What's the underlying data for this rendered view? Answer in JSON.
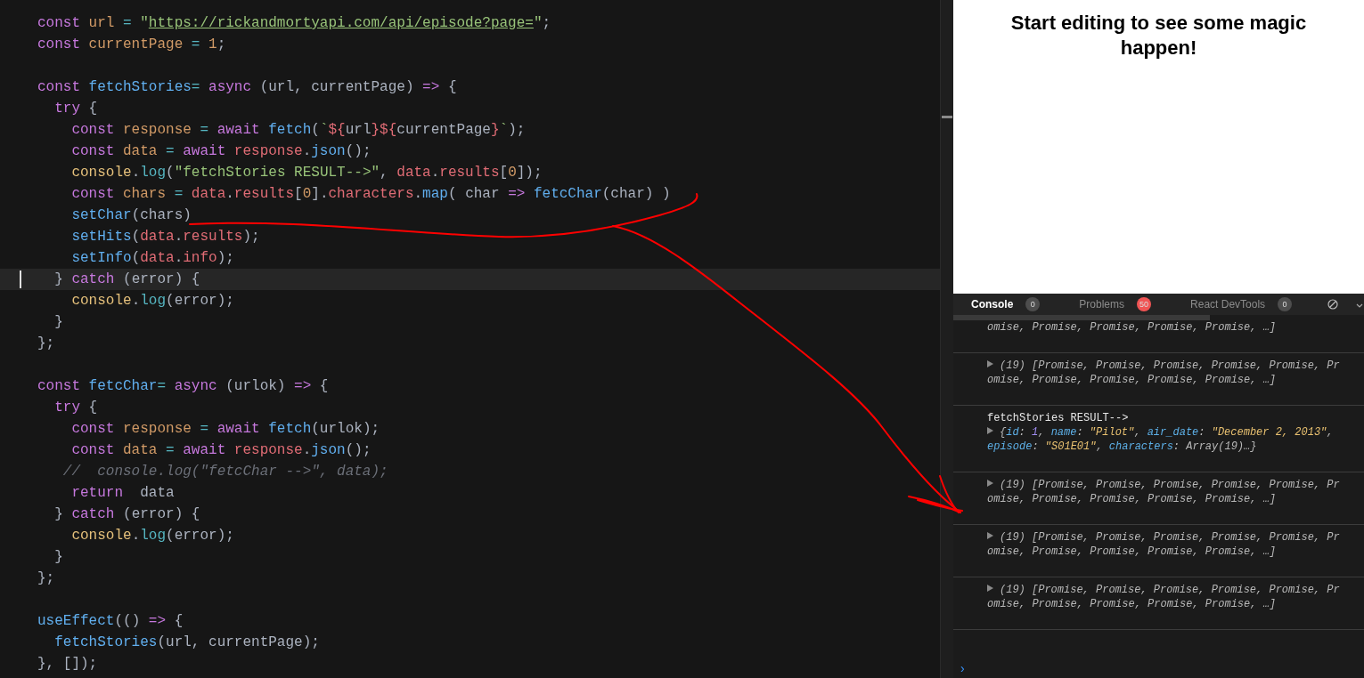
{
  "editor": {
    "lines": [
      {
        "current": false,
        "tokens": [
          {
            "kind": "keyword",
            "text": "const "
          },
          {
            "kind": "variable",
            "text": "url "
          },
          {
            "kind": "operator",
            "text": "= "
          },
          {
            "kind": "string",
            "text": "\""
          },
          {
            "kind": "link",
            "text": "https://rickandmortyapi.com/api/episode?page="
          },
          {
            "kind": "string",
            "text": "\""
          },
          {
            "kind": "plain",
            "text": ";"
          }
        ]
      },
      {
        "current": false,
        "tokens": [
          {
            "kind": "keyword",
            "text": "const "
          },
          {
            "kind": "variable",
            "text": "currentPage "
          },
          {
            "kind": "operator",
            "text": "= "
          },
          {
            "kind": "number",
            "text": "1"
          },
          {
            "kind": "plain",
            "text": ";"
          }
        ]
      },
      {
        "current": false,
        "blank_before": true,
        "tokens": [
          {
            "kind": "keyword",
            "text": "const "
          },
          {
            "kind": "function",
            "text": "fetchStories"
          },
          {
            "kind": "operator",
            "text": "= "
          },
          {
            "kind": "keyword",
            "text": "async"
          },
          {
            "kind": "plain",
            "text": " (url, currentPage) "
          },
          {
            "kind": "keyword",
            "text": "=>"
          },
          {
            "kind": "plain",
            "text": " {"
          }
        ]
      },
      {
        "current": false,
        "tokens": [
          {
            "kind": "keyword",
            "text": "  try"
          },
          {
            "kind": "plain",
            "text": " {"
          }
        ]
      },
      {
        "current": false,
        "tokens": [
          {
            "kind": "keyword",
            "text": "    const "
          },
          {
            "kind": "variable",
            "text": "response "
          },
          {
            "kind": "operator",
            "text": "= "
          },
          {
            "kind": "keyword",
            "text": "await "
          },
          {
            "kind": "function",
            "text": "fetch"
          },
          {
            "kind": "plain",
            "text": "("
          },
          {
            "kind": "string",
            "text": "`"
          },
          {
            "kind": "property",
            "text": "${"
          },
          {
            "kind": "plain",
            "text": "url"
          },
          {
            "kind": "property",
            "text": "}${"
          },
          {
            "kind": "plain",
            "text": "currentPage"
          },
          {
            "kind": "property",
            "text": "}"
          },
          {
            "kind": "string",
            "text": "`"
          },
          {
            "kind": "plain",
            "text": ");"
          }
        ]
      },
      {
        "current": false,
        "tokens": [
          {
            "kind": "keyword",
            "text": "    const "
          },
          {
            "kind": "variable",
            "text": "data "
          },
          {
            "kind": "operator",
            "text": "= "
          },
          {
            "kind": "keyword",
            "text": "await "
          },
          {
            "kind": "property",
            "text": "response"
          },
          {
            "kind": "plain",
            "text": "."
          },
          {
            "kind": "function",
            "text": "json"
          },
          {
            "kind": "plain",
            "text": "();"
          }
        ]
      },
      {
        "current": false,
        "tokens": [
          {
            "kind": "object",
            "text": "    console"
          },
          {
            "kind": "plain",
            "text": "."
          },
          {
            "kind": "method",
            "text": "log"
          },
          {
            "kind": "plain",
            "text": "("
          },
          {
            "kind": "string",
            "text": "\"fetchStories RESULT-->\""
          },
          {
            "kind": "plain",
            "text": ", "
          },
          {
            "kind": "property",
            "text": "data"
          },
          {
            "kind": "plain",
            "text": "."
          },
          {
            "kind": "property",
            "text": "results"
          },
          {
            "kind": "plain",
            "text": "["
          },
          {
            "kind": "number",
            "text": "0"
          },
          {
            "kind": "plain",
            "text": "]);"
          }
        ]
      },
      {
        "current": false,
        "tokens": [
          {
            "kind": "keyword",
            "text": "    const "
          },
          {
            "kind": "variable",
            "text": "chars "
          },
          {
            "kind": "operator",
            "text": "= "
          },
          {
            "kind": "property",
            "text": "data"
          },
          {
            "kind": "plain",
            "text": "."
          },
          {
            "kind": "property",
            "text": "results"
          },
          {
            "kind": "plain",
            "text": "["
          },
          {
            "kind": "number",
            "text": "0"
          },
          {
            "kind": "plain",
            "text": "]."
          },
          {
            "kind": "property",
            "text": "characters"
          },
          {
            "kind": "plain",
            "text": "."
          },
          {
            "kind": "function",
            "text": "map"
          },
          {
            "kind": "plain",
            "text": "( char "
          },
          {
            "kind": "keyword",
            "text": "=> "
          },
          {
            "kind": "function",
            "text": "fetcChar"
          },
          {
            "kind": "plain",
            "text": "(char) )"
          }
        ]
      },
      {
        "current": false,
        "tokens": [
          {
            "kind": "function",
            "text": "    setChar"
          },
          {
            "kind": "plain",
            "text": "(chars)"
          }
        ]
      },
      {
        "current": false,
        "tokens": [
          {
            "kind": "function",
            "text": "    setHits"
          },
          {
            "kind": "plain",
            "text": "("
          },
          {
            "kind": "property",
            "text": "data"
          },
          {
            "kind": "plain",
            "text": "."
          },
          {
            "kind": "property",
            "text": "results"
          },
          {
            "kind": "plain",
            "text": ");"
          }
        ]
      },
      {
        "current": false,
        "tokens": [
          {
            "kind": "function",
            "text": "    setInfo"
          },
          {
            "kind": "plain",
            "text": "("
          },
          {
            "kind": "property",
            "text": "data"
          },
          {
            "kind": "plain",
            "text": "."
          },
          {
            "kind": "property",
            "text": "info"
          },
          {
            "kind": "plain",
            "text": ");"
          }
        ]
      },
      {
        "current": true,
        "tokens": [
          {
            "kind": "plain",
            "text": "  } "
          },
          {
            "kind": "keyword",
            "text": "catch"
          },
          {
            "kind": "plain",
            "text": " (error) {"
          }
        ]
      },
      {
        "current": false,
        "tokens": [
          {
            "kind": "object",
            "text": "    console"
          },
          {
            "kind": "plain",
            "text": "."
          },
          {
            "kind": "method",
            "text": "log"
          },
          {
            "kind": "plain",
            "text": "(error);"
          }
        ]
      },
      {
        "current": false,
        "tokens": [
          {
            "kind": "plain",
            "text": "  }"
          }
        ]
      },
      {
        "current": false,
        "tokens": [
          {
            "kind": "plain",
            "text": "};"
          }
        ]
      },
      {
        "current": false,
        "blank_before": true,
        "tokens": [
          {
            "kind": "keyword",
            "text": "const "
          },
          {
            "kind": "function",
            "text": "fetcChar"
          },
          {
            "kind": "operator",
            "text": "= "
          },
          {
            "kind": "keyword",
            "text": "async"
          },
          {
            "kind": "plain",
            "text": " (urlok) "
          },
          {
            "kind": "keyword",
            "text": "=>"
          },
          {
            "kind": "plain",
            "text": " {"
          }
        ]
      },
      {
        "current": false,
        "tokens": [
          {
            "kind": "keyword",
            "text": "  try"
          },
          {
            "kind": "plain",
            "text": " {"
          }
        ]
      },
      {
        "current": false,
        "tokens": [
          {
            "kind": "keyword",
            "text": "    const "
          },
          {
            "kind": "variable",
            "text": "response "
          },
          {
            "kind": "operator",
            "text": "= "
          },
          {
            "kind": "keyword",
            "text": "await "
          },
          {
            "kind": "function",
            "text": "fetch"
          },
          {
            "kind": "plain",
            "text": "(urlok);"
          }
        ]
      },
      {
        "current": false,
        "tokens": [
          {
            "kind": "keyword",
            "text": "    const "
          },
          {
            "kind": "variable",
            "text": "data "
          },
          {
            "kind": "operator",
            "text": "= "
          },
          {
            "kind": "keyword",
            "text": "await "
          },
          {
            "kind": "property",
            "text": "response"
          },
          {
            "kind": "plain",
            "text": "."
          },
          {
            "kind": "function",
            "text": "json"
          },
          {
            "kind": "plain",
            "text": "();"
          }
        ]
      },
      {
        "current": false,
        "tokens": [
          {
            "kind": "comment",
            "text": "   //  console.log(\"fetcChar -->\", data);"
          }
        ]
      },
      {
        "current": false,
        "tokens": [
          {
            "kind": "keyword",
            "text": "    return"
          },
          {
            "kind": "plain",
            "text": "  data"
          }
        ]
      },
      {
        "current": false,
        "tokens": [
          {
            "kind": "plain",
            "text": "  } "
          },
          {
            "kind": "keyword",
            "text": "catch"
          },
          {
            "kind": "plain",
            "text": " (error) {"
          }
        ]
      },
      {
        "current": false,
        "tokens": [
          {
            "kind": "object",
            "text": "    console"
          },
          {
            "kind": "plain",
            "text": "."
          },
          {
            "kind": "method",
            "text": "log"
          },
          {
            "kind": "plain",
            "text": "(error);"
          }
        ]
      },
      {
        "current": false,
        "tokens": [
          {
            "kind": "plain",
            "text": "  }"
          }
        ]
      },
      {
        "current": false,
        "tokens": [
          {
            "kind": "plain",
            "text": "};"
          }
        ]
      },
      {
        "current": false,
        "blank_before": true,
        "tokens": [
          {
            "kind": "function",
            "text": "useEffect"
          },
          {
            "kind": "plain",
            "text": "(() "
          },
          {
            "kind": "keyword",
            "text": "=>"
          },
          {
            "kind": "plain",
            "text": " {"
          }
        ]
      },
      {
        "current": false,
        "tokens": [
          {
            "kind": "function",
            "text": "  fetchStories"
          },
          {
            "kind": "plain",
            "text": "(url, currentPage);"
          }
        ]
      },
      {
        "current": false,
        "tokens": [
          {
            "kind": "plain",
            "text": "}, []);"
          }
        ]
      }
    ]
  },
  "preview": {
    "heading": "Start editing to see some magic happen!"
  },
  "console": {
    "tabs": [
      {
        "label": "Console",
        "count": "0",
        "color": "#4d4d4d",
        "selected": true
      },
      {
        "label": "Problems",
        "count": "50",
        "color": "#f05454",
        "selected": false
      },
      {
        "label": "React DevTools",
        "count": "0",
        "color": "#4d4d4d",
        "selected": false
      }
    ],
    "entries": [
      {
        "expandable": false,
        "lines": [
          [
            {
              "kind": "plain",
              "text": "omise, Promise, Promise, Promise, Promise, …]"
            }
          ]
        ]
      },
      {
        "expandable": true,
        "lines": [
          [
            {
              "kind": "plain",
              "text": "(19) [Promise, Promise, Promise, Promise, Promise, Pr"
            }
          ],
          [
            {
              "kind": "plain",
              "text": "omise, Promise, Promise, Promise, Promise, …]"
            }
          ]
        ]
      },
      {
        "expandable": true,
        "label": "fetchStories RESULT-->",
        "lines": [
          [
            {
              "kind": "plain",
              "text": "{"
            },
            {
              "kind": "key",
              "text": "id"
            },
            {
              "kind": "plain",
              "text": ": "
            },
            {
              "kind": "number",
              "text": "1"
            },
            {
              "kind": "plain",
              "text": ", "
            },
            {
              "kind": "key",
              "text": "name"
            },
            {
              "kind": "plain",
              "text": ": "
            },
            {
              "kind": "string",
              "text": "\"Pilot\""
            },
            {
              "kind": "plain",
              "text": ", "
            },
            {
              "kind": "key",
              "text": "air_date"
            },
            {
              "kind": "plain",
              "text": ": "
            },
            {
              "kind": "string",
              "text": "\"December 2, 2013\""
            },
            {
              "kind": "plain",
              "text": ","
            }
          ],
          [
            {
              "kind": "key",
              "text": "episode"
            },
            {
              "kind": "plain",
              "text": ": "
            },
            {
              "kind": "string",
              "text": "\"S01E01\""
            },
            {
              "kind": "plain",
              "text": ", "
            },
            {
              "kind": "key",
              "text": "characters"
            },
            {
              "kind": "plain",
              "text": ": Array(19)…}"
            }
          ]
        ]
      },
      {
        "expandable": true,
        "lines": [
          [
            {
              "kind": "plain",
              "text": "(19) [Promise, Promise, Promise, Promise, Promise, Pr"
            }
          ],
          [
            {
              "kind": "plain",
              "text": "omise, Promise, Promise, Promise, Promise, …]"
            }
          ]
        ]
      },
      {
        "expandable": true,
        "lines": [
          [
            {
              "kind": "plain",
              "text": "(19) [Promise, Promise, Promise, Promise, Promise, Pr"
            }
          ],
          [
            {
              "kind": "plain",
              "text": "omise, Promise, Promise, Promise, Promise, …]"
            }
          ]
        ]
      },
      {
        "expandable": true,
        "lines": [
          [
            {
              "kind": "plain",
              "text": "(19) [Promise, Promise, Promise, Promise, Promise, Pr"
            }
          ],
          [
            {
              "kind": "plain",
              "text": "omise, Promise, Promise, Promise, Promise, …]"
            }
          ]
        ]
      }
    ],
    "prompt": "›"
  }
}
